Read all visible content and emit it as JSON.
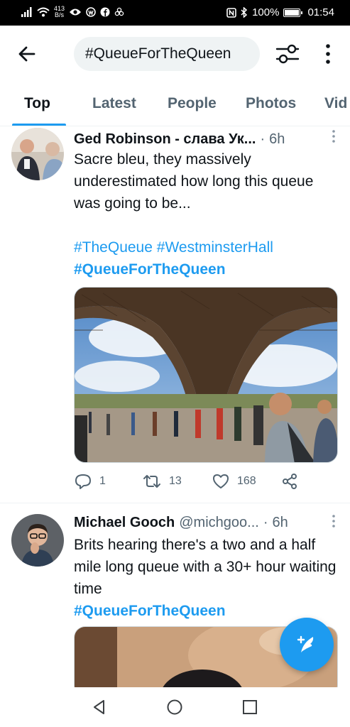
{
  "status_bar": {
    "speed_value": "413",
    "speed_unit": "B/s",
    "battery": "100%",
    "battery_level": 1.0,
    "time": "01:54"
  },
  "header": {
    "search_query": "#QueueForTheQueen"
  },
  "tabs": [
    {
      "label": "Top",
      "active": true
    },
    {
      "label": "Latest"
    },
    {
      "label": "People"
    },
    {
      "label": "Photos"
    },
    {
      "label": "Vid"
    }
  ],
  "tweets": [
    {
      "name": "Ged Robinson - слава Ук...",
      "handle": "",
      "time": "6h",
      "text": "Sacre bleu, they massively underestimated how long this queue was going to be...",
      "hashtags_line1": [
        "#TheQueue",
        "#WestminsterHall"
      ],
      "hashtag_bold": "#QueueForTheQueen",
      "replies": "1",
      "retweets": "13",
      "likes": "168"
    },
    {
      "name": "Michael Gooch",
      "handle": "@michgoo...",
      "time": "6h",
      "text": "Brits hearing there's a two and a half mile long queue with a 30+ hour waiting time",
      "hashtag_bold": "#QueueForTheQueen"
    }
  ],
  "colors": {
    "accent": "#1d9bf0",
    "text": "#0f1419",
    "secondary": "#536471"
  },
  "icons": [
    "back-arrow-icon",
    "filter-icon",
    "more-vertical-icon",
    "reply-icon",
    "retweet-icon",
    "like-icon",
    "share-icon",
    "compose-icon",
    "nav-back-icon",
    "nav-home-icon",
    "nav-recents-icon"
  ]
}
